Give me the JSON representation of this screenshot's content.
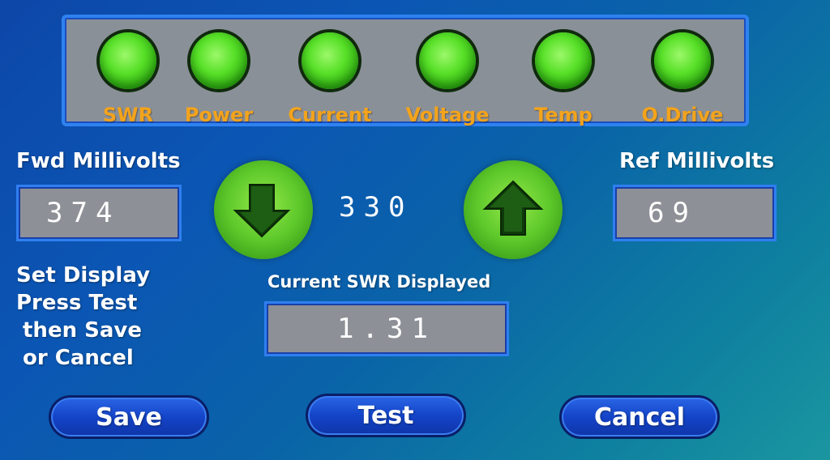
{
  "indicators": [
    {
      "label": "SWR",
      "status": "on"
    },
    {
      "label": "Power",
      "status": "on"
    },
    {
      "label": "Current",
      "status": "on"
    },
    {
      "label": "Voltage",
      "status": "on"
    },
    {
      "label": "Temp",
      "status": "on"
    },
    {
      "label": "O.Drive",
      "status": "on"
    }
  ],
  "fwd": {
    "label": "Fwd Millivolts",
    "value": "374"
  },
  "ref": {
    "label": "Ref Millivolts",
    "value": "69"
  },
  "adjust": {
    "value": "330",
    "down_icon": "arrow-down-icon",
    "up_icon": "arrow-up-icon"
  },
  "instructions": {
    "line1": "Set Display",
    "line2": "Press Test",
    "line3": "then Save",
    "line4": "or Cancel"
  },
  "swr_display": {
    "label": "Current SWR Displayed",
    "value": "1.31"
  },
  "buttons": {
    "save": "Save",
    "test": "Test",
    "cancel": "Cancel"
  },
  "colors": {
    "led_on": "#58e028",
    "indicator_label": "#f3a31c",
    "panel": "#8a9098",
    "accent_border": "#2f82f0",
    "button": "#1444c8"
  }
}
